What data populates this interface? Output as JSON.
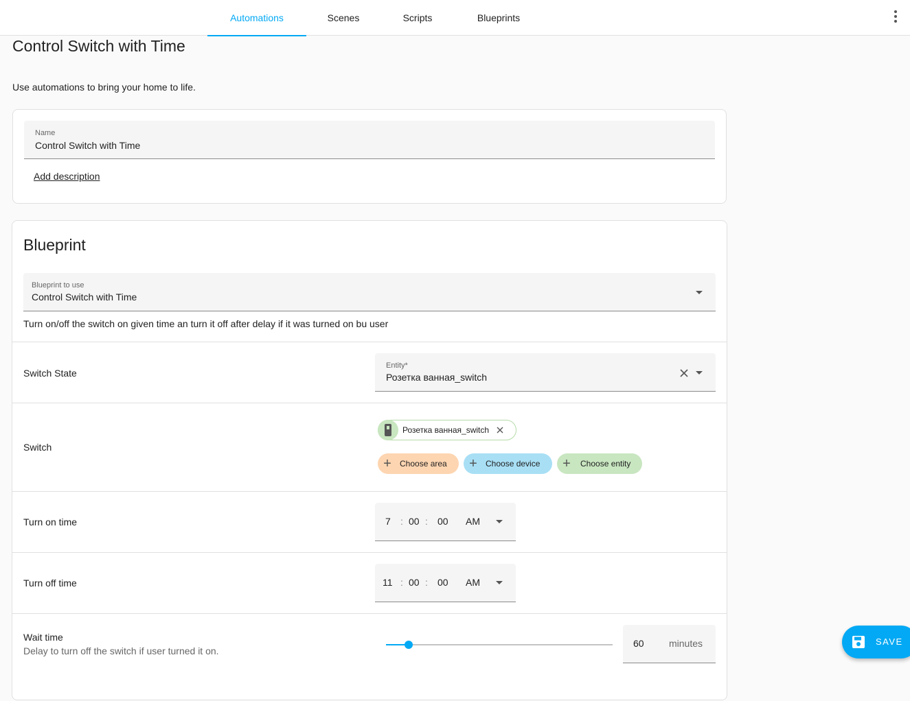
{
  "tabs": [
    {
      "label": "Automations"
    },
    {
      "label": "Scenes"
    },
    {
      "label": "Scripts"
    },
    {
      "label": "Blueprints"
    }
  ],
  "page": {
    "title": "Control Switch with Time",
    "description": "Use automations to bring your home to life."
  },
  "name_card": {
    "name_label": "Name",
    "name_value": "Control Switch with Time",
    "add_description": "Add description"
  },
  "blueprint": {
    "section_title": "Blueprint",
    "select_label": "Blueprint to use",
    "select_value": "Control Switch with Time",
    "description": "Turn on/off the switch on given time an turn it off after delay if it was turned on bu user"
  },
  "inputs": {
    "switch_state": {
      "label": "Switch State",
      "entity_label": "Entity*",
      "entity_value": "Розетка ванная_switch"
    },
    "switch": {
      "label": "Switch",
      "selected_chip": "Розетка ванная_switch",
      "choose_area": "Choose area",
      "choose_device": "Choose device",
      "choose_entity": "Choose entity"
    },
    "turn_on_time": {
      "label": "Turn on time",
      "hours": "7",
      "minutes": "00",
      "seconds": "00",
      "ampm": "AM"
    },
    "turn_off_time": {
      "label": "Turn off time",
      "hours": "11",
      "minutes": "00",
      "seconds": "00",
      "ampm": "AM"
    },
    "wait_time": {
      "label": "Wait time",
      "description": "Delay to turn off the switch if user turned it on.",
      "value": "60",
      "unit": "minutes",
      "slider_fraction": 0.1
    }
  },
  "fab": {
    "save_label": "SAVE"
  },
  "colors": {
    "accent": "#03a9f4",
    "chip_area": "#fdd5b1",
    "chip_device": "#a8dff5",
    "chip_entity": "#c8e6c0"
  }
}
